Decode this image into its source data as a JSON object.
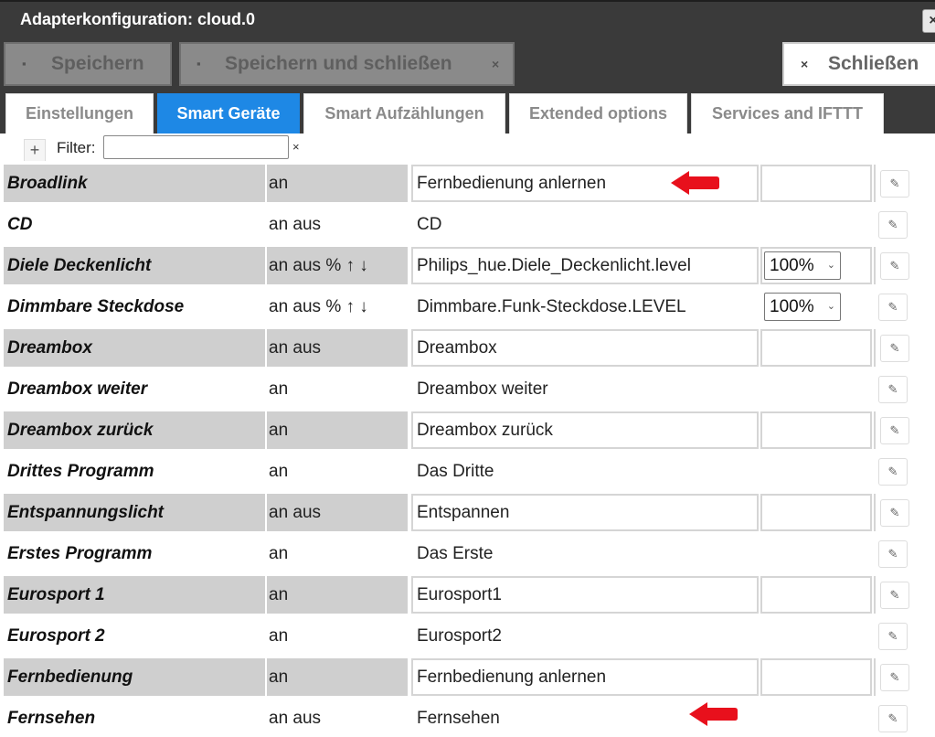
{
  "titlebar": {
    "title": "Adapterkonfiguration: cloud.0",
    "close_icon": "×"
  },
  "toolbar": {
    "save_label": "Speichern",
    "save_close_label": "Speichern und schließen",
    "close_label": "Schließen",
    "disk_icon": "▪",
    "x_icon": "×"
  },
  "tabs": [
    {
      "label": "Einstellungen",
      "active": false
    },
    {
      "label": "Smart Geräte",
      "active": true
    },
    {
      "label": "Smart Aufzählungen",
      "active": false
    },
    {
      "label": "Extended options",
      "active": false
    },
    {
      "label": "Services and IFTTT",
      "active": false
    }
  ],
  "filter": {
    "label": "Filter:",
    "value": "",
    "plus_icon": "+",
    "clear_icon": "×"
  },
  "rows": [
    {
      "name": "Broadlink",
      "actions": "an",
      "id": "Fernbedienung anlernen",
      "extra": ""
    },
    {
      "name": "CD",
      "actions": "an aus",
      "id": "CD",
      "extra": ""
    },
    {
      "name": "Diele Deckenlicht",
      "actions": "an aus % ↑ ↓",
      "id": "Philips_hue.Diele_Deckenlicht.level",
      "extra": "100%"
    },
    {
      "name": "Dimmbare Steckdose",
      "actions": "an aus % ↑ ↓",
      "id": "Dimmbare.Funk-Steckdose.LEVEL",
      "extra": "100%"
    },
    {
      "name": "Dreambox",
      "actions": "an aus",
      "id": "Dreambox",
      "extra": ""
    },
    {
      "name": "Dreambox weiter",
      "actions": "an",
      "id": "Dreambox weiter",
      "extra": ""
    },
    {
      "name": "Dreambox zurück",
      "actions": "an",
      "id": "Dreambox zurück",
      "extra": ""
    },
    {
      "name": "Drittes Programm",
      "actions": "an",
      "id": "Das Dritte",
      "extra": ""
    },
    {
      "name": "Entspannungslicht",
      "actions": "an aus",
      "id": "Entspannen",
      "extra": ""
    },
    {
      "name": "Erstes Programm",
      "actions": "an",
      "id": "Das Erste",
      "extra": ""
    },
    {
      "name": "Eurosport 1",
      "actions": "an",
      "id": "Eurosport1",
      "extra": ""
    },
    {
      "name": "Eurosport 2",
      "actions": "an",
      "id": "Eurosport2",
      "extra": ""
    },
    {
      "name": "Fernbedienung",
      "actions": "an",
      "id": "Fernbedienung anlernen",
      "extra": ""
    },
    {
      "name": "Fernsehen",
      "actions": "an aus",
      "id": "Fernsehen",
      "extra": ""
    }
  ],
  "edit_icon": "✎",
  "chevron_icon": "⌄",
  "colors": {
    "accent": "#1e88e5",
    "header_bg": "#3a3a3a",
    "row_shade": "#cfcfcf",
    "arrow": "#e8101c"
  }
}
